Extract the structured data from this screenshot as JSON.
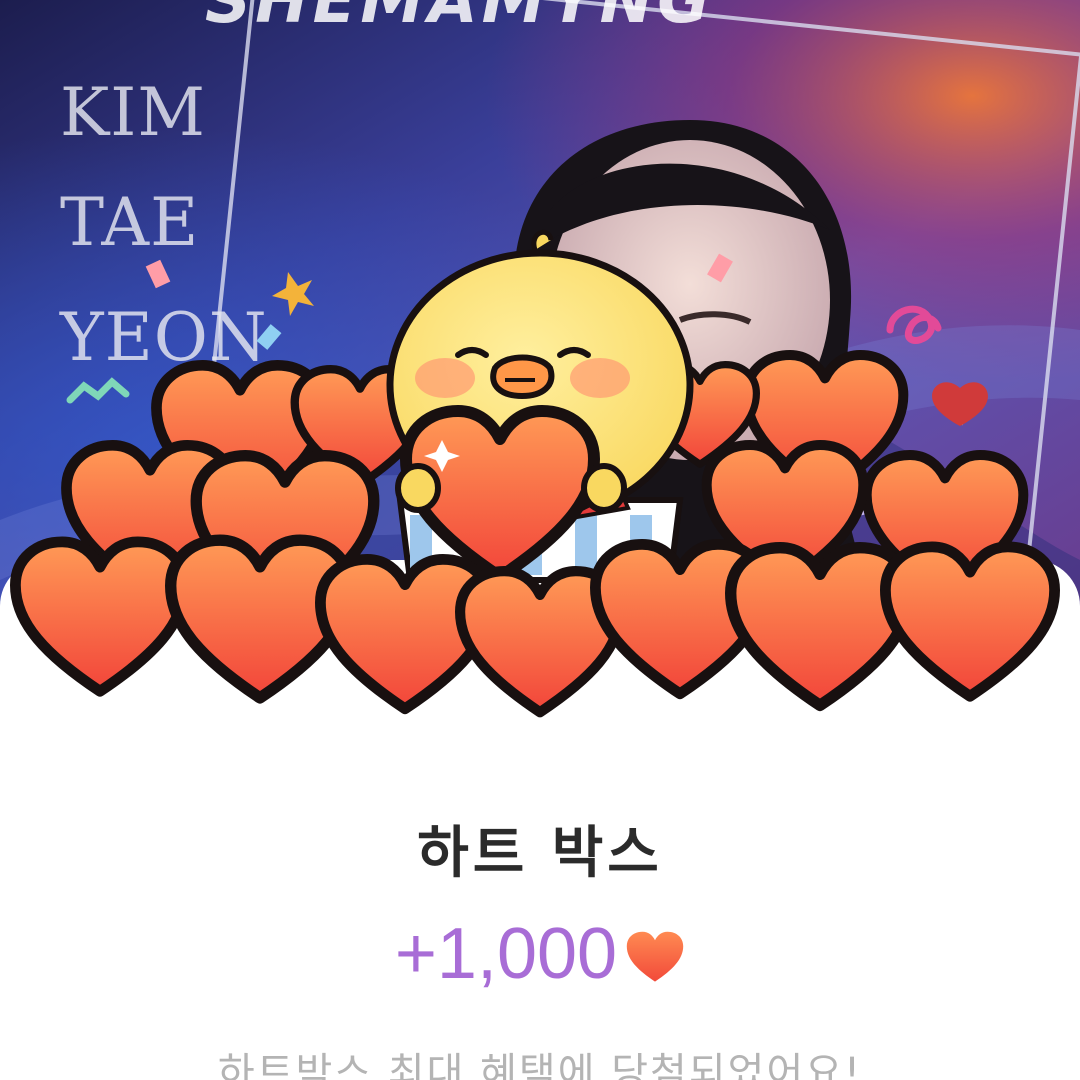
{
  "poster": {
    "top_text": "SHEMAMYNG",
    "name_lines": [
      "KIM",
      "TAE",
      "YEON"
    ]
  },
  "reward": {
    "title": "하트 박스",
    "amount": "+1,000",
    "currency_icon": "heart-icon",
    "description": "하트박스 최대 혜택에 당첨되었어요!"
  },
  "colors": {
    "amount": "#a86dd6",
    "title": "#2b2b2b",
    "description": "#b4b4b4",
    "heart_top": "#ff8a52",
    "heart_bottom": "#f24a3a"
  }
}
